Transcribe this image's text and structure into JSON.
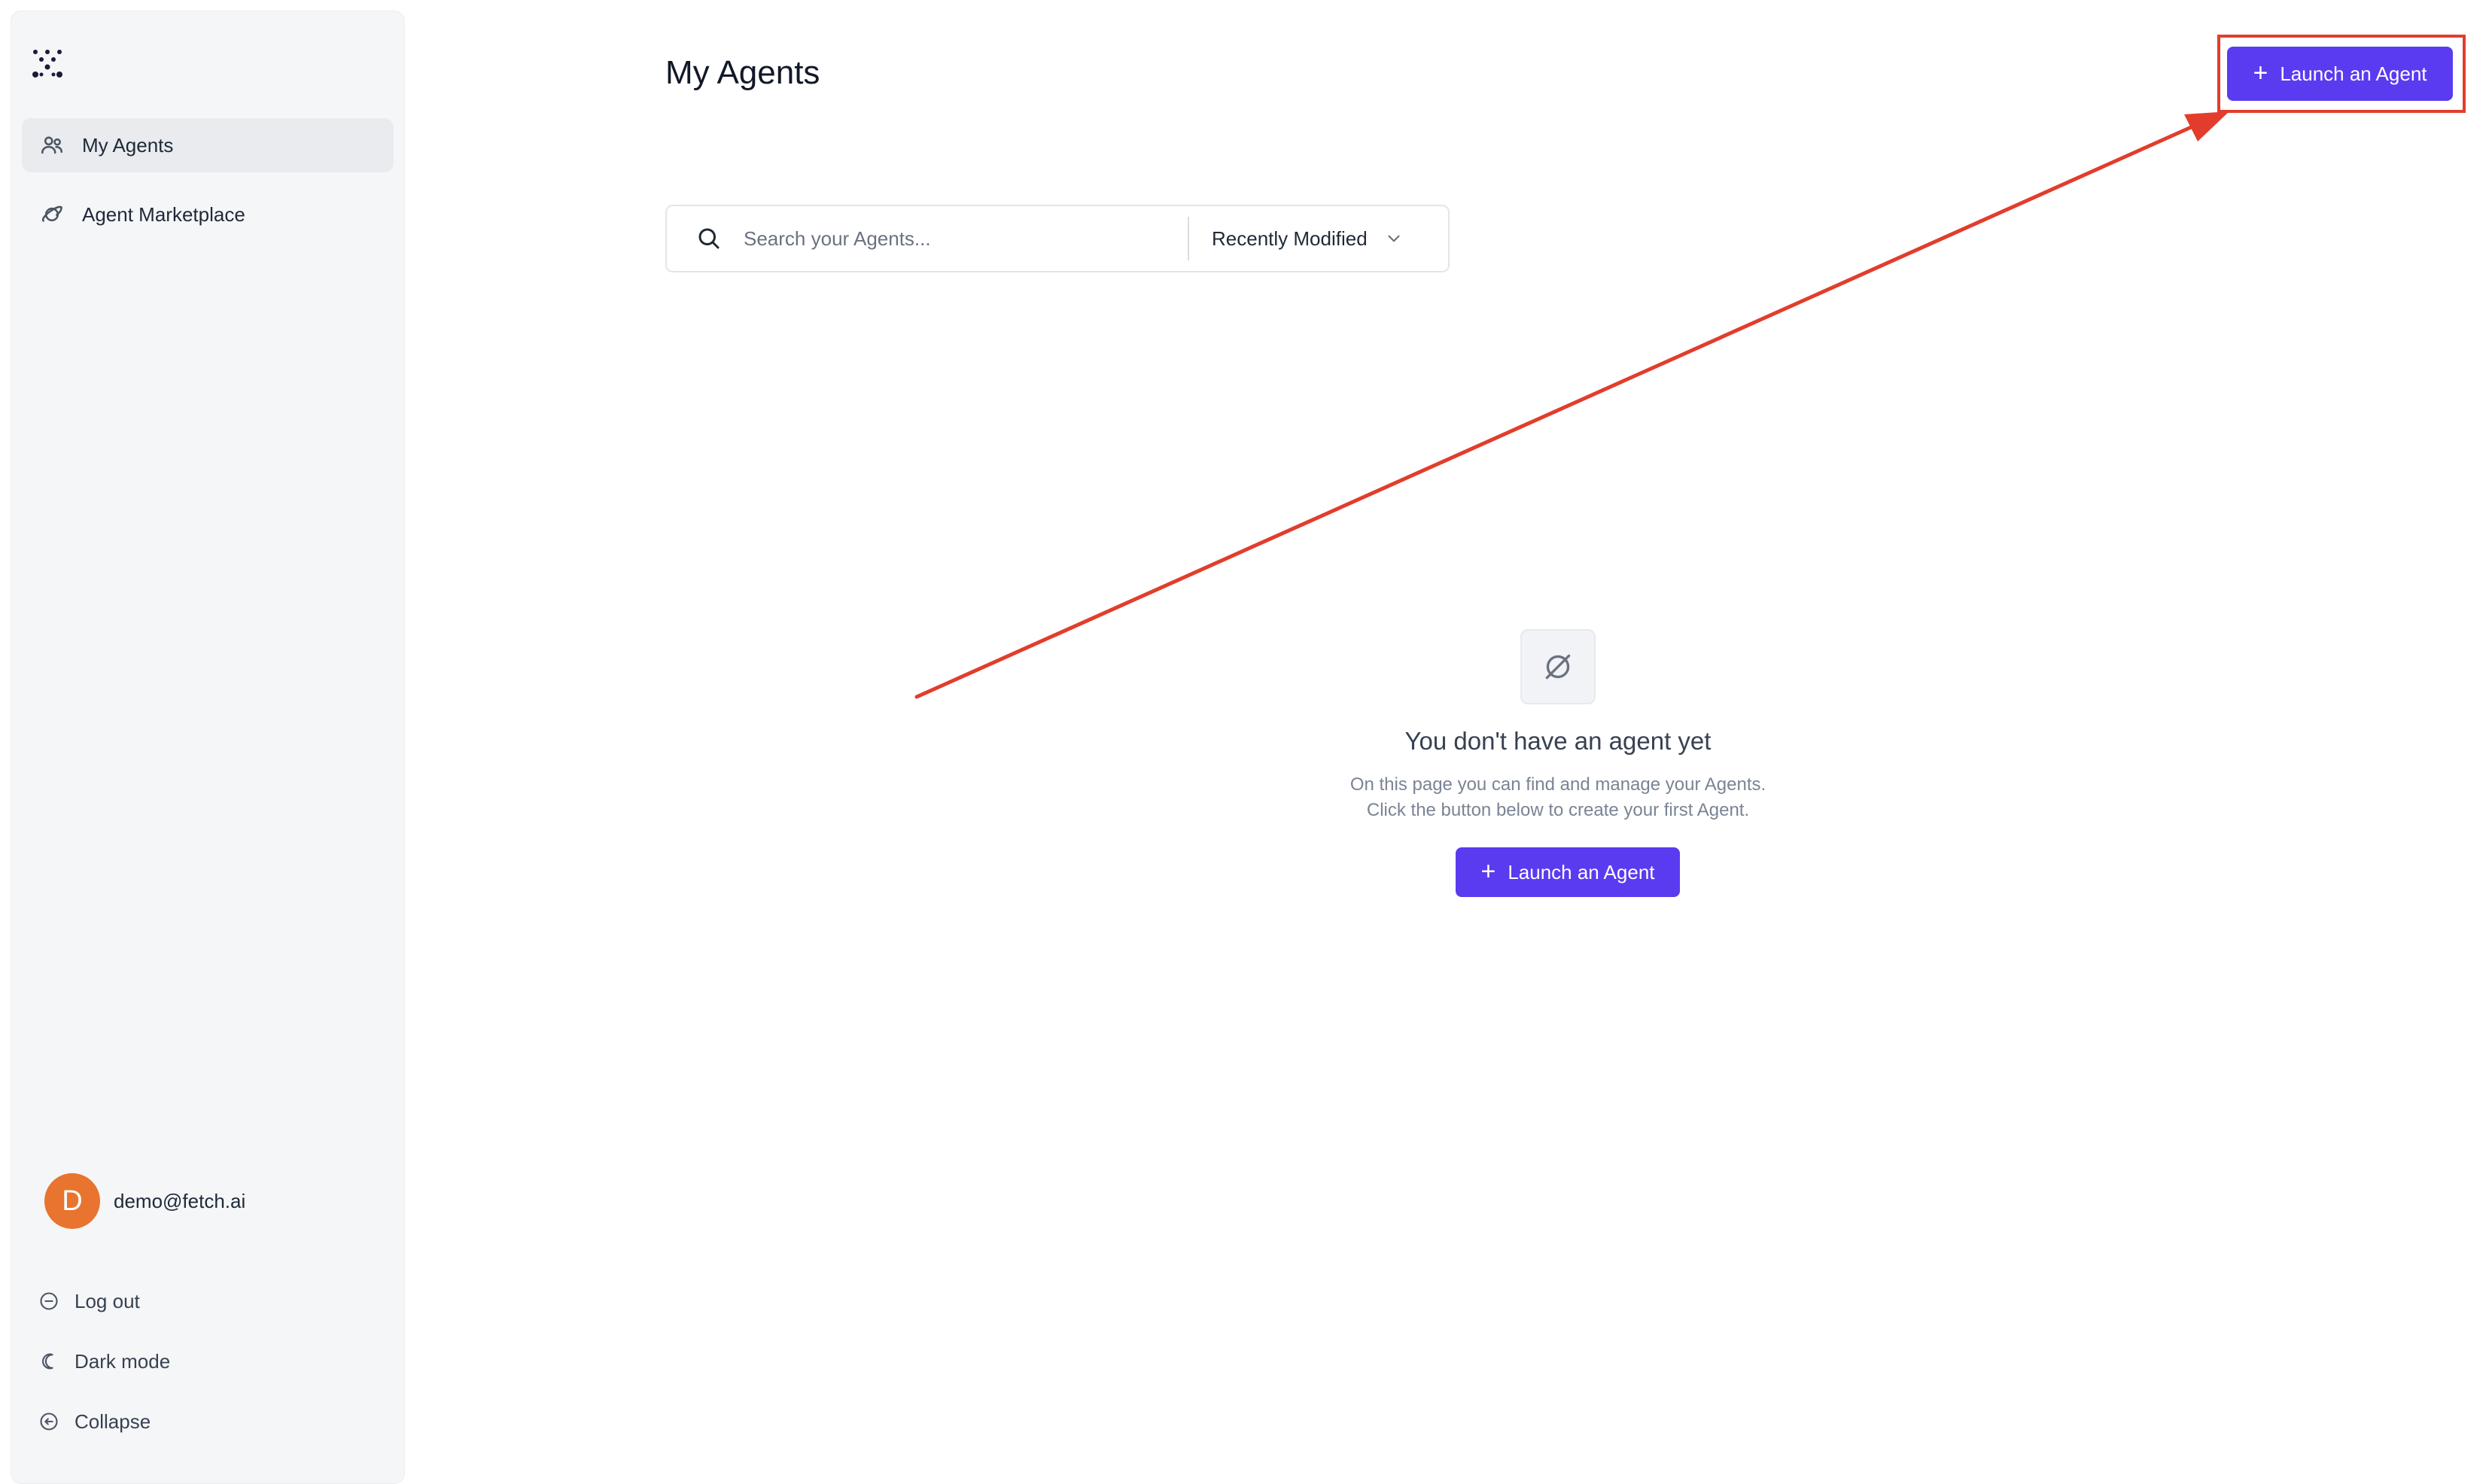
{
  "sidebar": {
    "items": [
      {
        "label": "My Agents",
        "icon": "users-icon",
        "active": true
      },
      {
        "label": "Agent Marketplace",
        "icon": "planet-icon",
        "active": false
      }
    ],
    "user": {
      "initial": "D",
      "email": "demo@fetch.ai"
    },
    "bottom": {
      "logout": "Log out",
      "dark_mode": "Dark mode",
      "collapse": "Collapse"
    }
  },
  "main": {
    "title": "My Agents",
    "launch_button": "Launch an Agent",
    "search": {
      "placeholder": "Search your Agents..."
    },
    "sort": {
      "selected": "Recently Modified"
    },
    "empty": {
      "title": "You don't have an agent yet",
      "line1": "On this page you can find and manage your Agents.",
      "line2": "Click the button below to create your first Agent.",
      "button": "Launch an Agent"
    }
  },
  "colors": {
    "accent": "#5a3bf0",
    "annotation": "#e23d2c",
    "avatar": "#e8742f"
  }
}
